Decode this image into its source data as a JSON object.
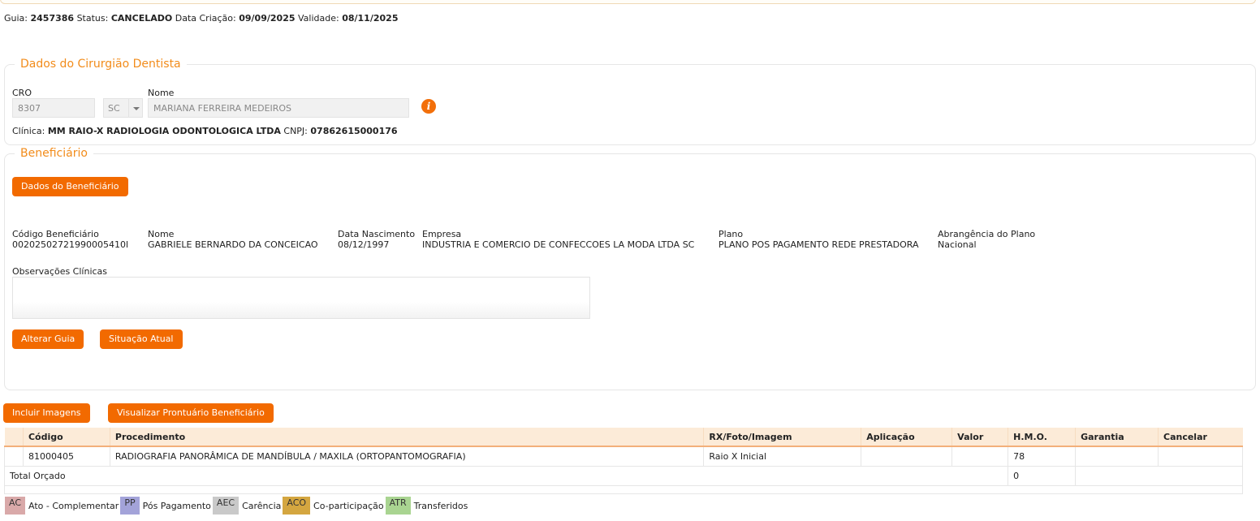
{
  "header": {
    "guia_label": "Guia:",
    "guia_value": "2457386",
    "status_label": "Status:",
    "status_value": "CANCELADO",
    "criacao_label": "Data Criação:",
    "criacao_value": "09/09/2025",
    "validade_label": "Validade:",
    "validade_value": "08/11/2025"
  },
  "dentist": {
    "legend": "Dados do Cirurgião Dentista",
    "cro_label": "CRO",
    "cro_value": "8307",
    "uf_value": "SC",
    "nome_label": "Nome",
    "nome_value": "MARIANA FERREIRA MEDEIROS",
    "info_icon": "i",
    "clinica_label": "Clínica:",
    "clinica_value": "MM RAIO-X RADIOLOGIA ODONTOLOGICA LTDA",
    "cnpj_label": "CNPJ:",
    "cnpj_value": "07862615000176"
  },
  "beneficiary": {
    "legend": "Beneficiário",
    "dados_button": "Dados do Beneficiário",
    "codigo_label": "Código Beneficiário",
    "codigo_value": "00202502721990005410l",
    "nome_label": "Nome",
    "nome_value": "GABRIELE BERNARDO DA CONCEICAO",
    "nasc_label": "Data Nascimento",
    "nasc_value": "08/12/1997",
    "empresa_label": "Empresa",
    "empresa_value": "INDUSTRIA E COMERCIO DE CONFECCOES LA MODA LTDA SC",
    "plano_label": "Plano",
    "plano_value": "PLANO POS PAGAMENTO REDE PRESTADORA",
    "abrang_label": "Abrangência do Plano",
    "abrang_value": "Nacional",
    "obs_label": "Observações Clínicas",
    "obs_value": "",
    "alterar_button": "Alterar Guia",
    "situacao_button": "Situação Atual"
  },
  "actions": {
    "incluir_button": "Incluir Imagens",
    "prontuario_button": "Visualizar Prontuário Beneficiário"
  },
  "table": {
    "headers": [
      "",
      "Código",
      "Procedimento",
      "RX/Foto/Imagem",
      "Aplicação",
      "Valor",
      "H.M.O.",
      "Garantia",
      "Cancelar"
    ],
    "rows": [
      [
        "",
        "81000405",
        "RADIOGRAFIA PANORÂMICA DE MANDÍBULA / MAXILA (ORTOPANTOMOGRAFIA)",
        "Raio X Inicial",
        "",
        "",
        "78",
        "",
        ""
      ]
    ],
    "total_label": "Total Orçado",
    "total_hmo": "0"
  },
  "legend": [
    {
      "code": "AC",
      "label": "Ato - Complementar",
      "color": "#d9a9a9"
    },
    {
      "code": "PP",
      "label": "Pós Pagamento",
      "color": "#a3a3d9"
    },
    {
      "code": "AEC",
      "label": "Carência",
      "color": "#c9c9c9"
    },
    {
      "code": "ACO",
      "label": "Co-participação",
      "color": "#d4a640"
    },
    {
      "code": "ATR",
      "label": "Transferidos",
      "color": "#a9d491"
    }
  ]
}
